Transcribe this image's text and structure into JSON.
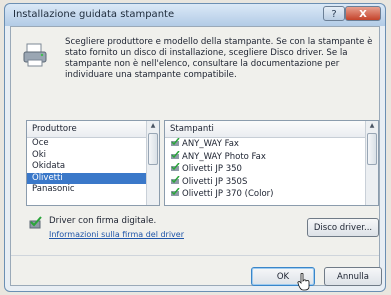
{
  "window": {
    "title": "Installazione guidata stampante",
    "help": "?",
    "close": "X"
  },
  "intro": "Scegliere produttore e modello della stampante. Se con la stampante è stato fornito un disco di installazione, scegliere Disco driver. Se la stampante non è nell'elenco, consultare la documentazione per individuare una stampante compatibile.",
  "manufacturers": {
    "header": "Produttore",
    "items": [
      "Oce",
      "Oki",
      "Okidata",
      "Olivetti",
      "Panasonic"
    ],
    "selected_index": 3
  },
  "printers": {
    "header": "Stampanti",
    "items": [
      "ANY_WAY Fax",
      "ANY_WAY Photo Fax",
      "Olivetti JP 350",
      "Olivetti JP 350S",
      "Olivetti JP 370 (Color)"
    ]
  },
  "signature": {
    "text": "Driver con firma digitale.",
    "link": "Informazioni sulla firma del driver"
  },
  "buttons": {
    "disk": "Disco driver...",
    "ok": "OK",
    "cancel": "Annulla"
  },
  "colors": {
    "selection": "#3a78c9",
    "link": "#1e54a8"
  }
}
